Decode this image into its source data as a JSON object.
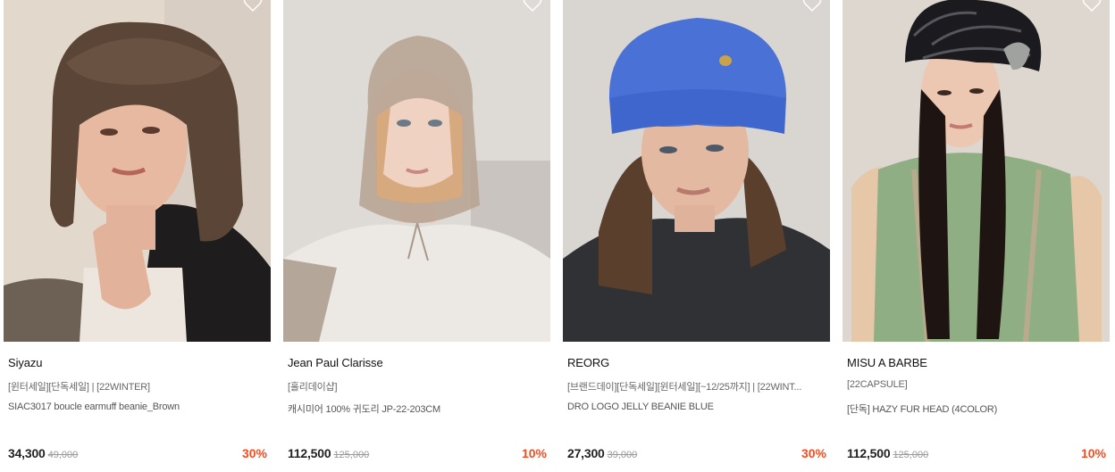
{
  "products": [
    {
      "brand": "Siyazu",
      "tags": "[윈터세일][단독세일] | [22WINTER]",
      "name": "SIAC3017 boucle earmuff beanie_Brown",
      "price": "34,300",
      "original_price": "49,000",
      "discount": "30%",
      "image_desc": "model wearing brown boucle earmuff beanie"
    },
    {
      "brand": "Jean Paul Clarisse",
      "tags": "[홀리데이샵]",
      "name": "캐시미어 100% 귀도리 JP-22-203CM",
      "price": "112,500",
      "original_price": "125,000",
      "discount": "10%",
      "image_desc": "model wearing beige cashmere knit bonnet"
    },
    {
      "brand": "REORG",
      "tags": "[브랜드데이][단독세일][윈터세일][~12/25까지] | [22WINT...",
      "name": "DRO LOGO JELLY BEANIE BLUE",
      "price": "27,300",
      "original_price": "39,000",
      "discount": "30%",
      "image_desc": "model wearing blue beanie"
    },
    {
      "brand": "MISU A BARBE",
      "tags": "[22CAPSULE]",
      "name": "[단독] HAZY FUR HEAD (4COLOR)",
      "price": "112,500",
      "original_price": "125,000",
      "discount": "10%",
      "image_desc": "model wearing black fuzzy fur hat"
    }
  ],
  "colors": {
    "discount": "#f04e23",
    "price": "#222222",
    "original_price": "#9a9a9a"
  },
  "icons": {
    "wishlist": "heart-outline-icon"
  }
}
